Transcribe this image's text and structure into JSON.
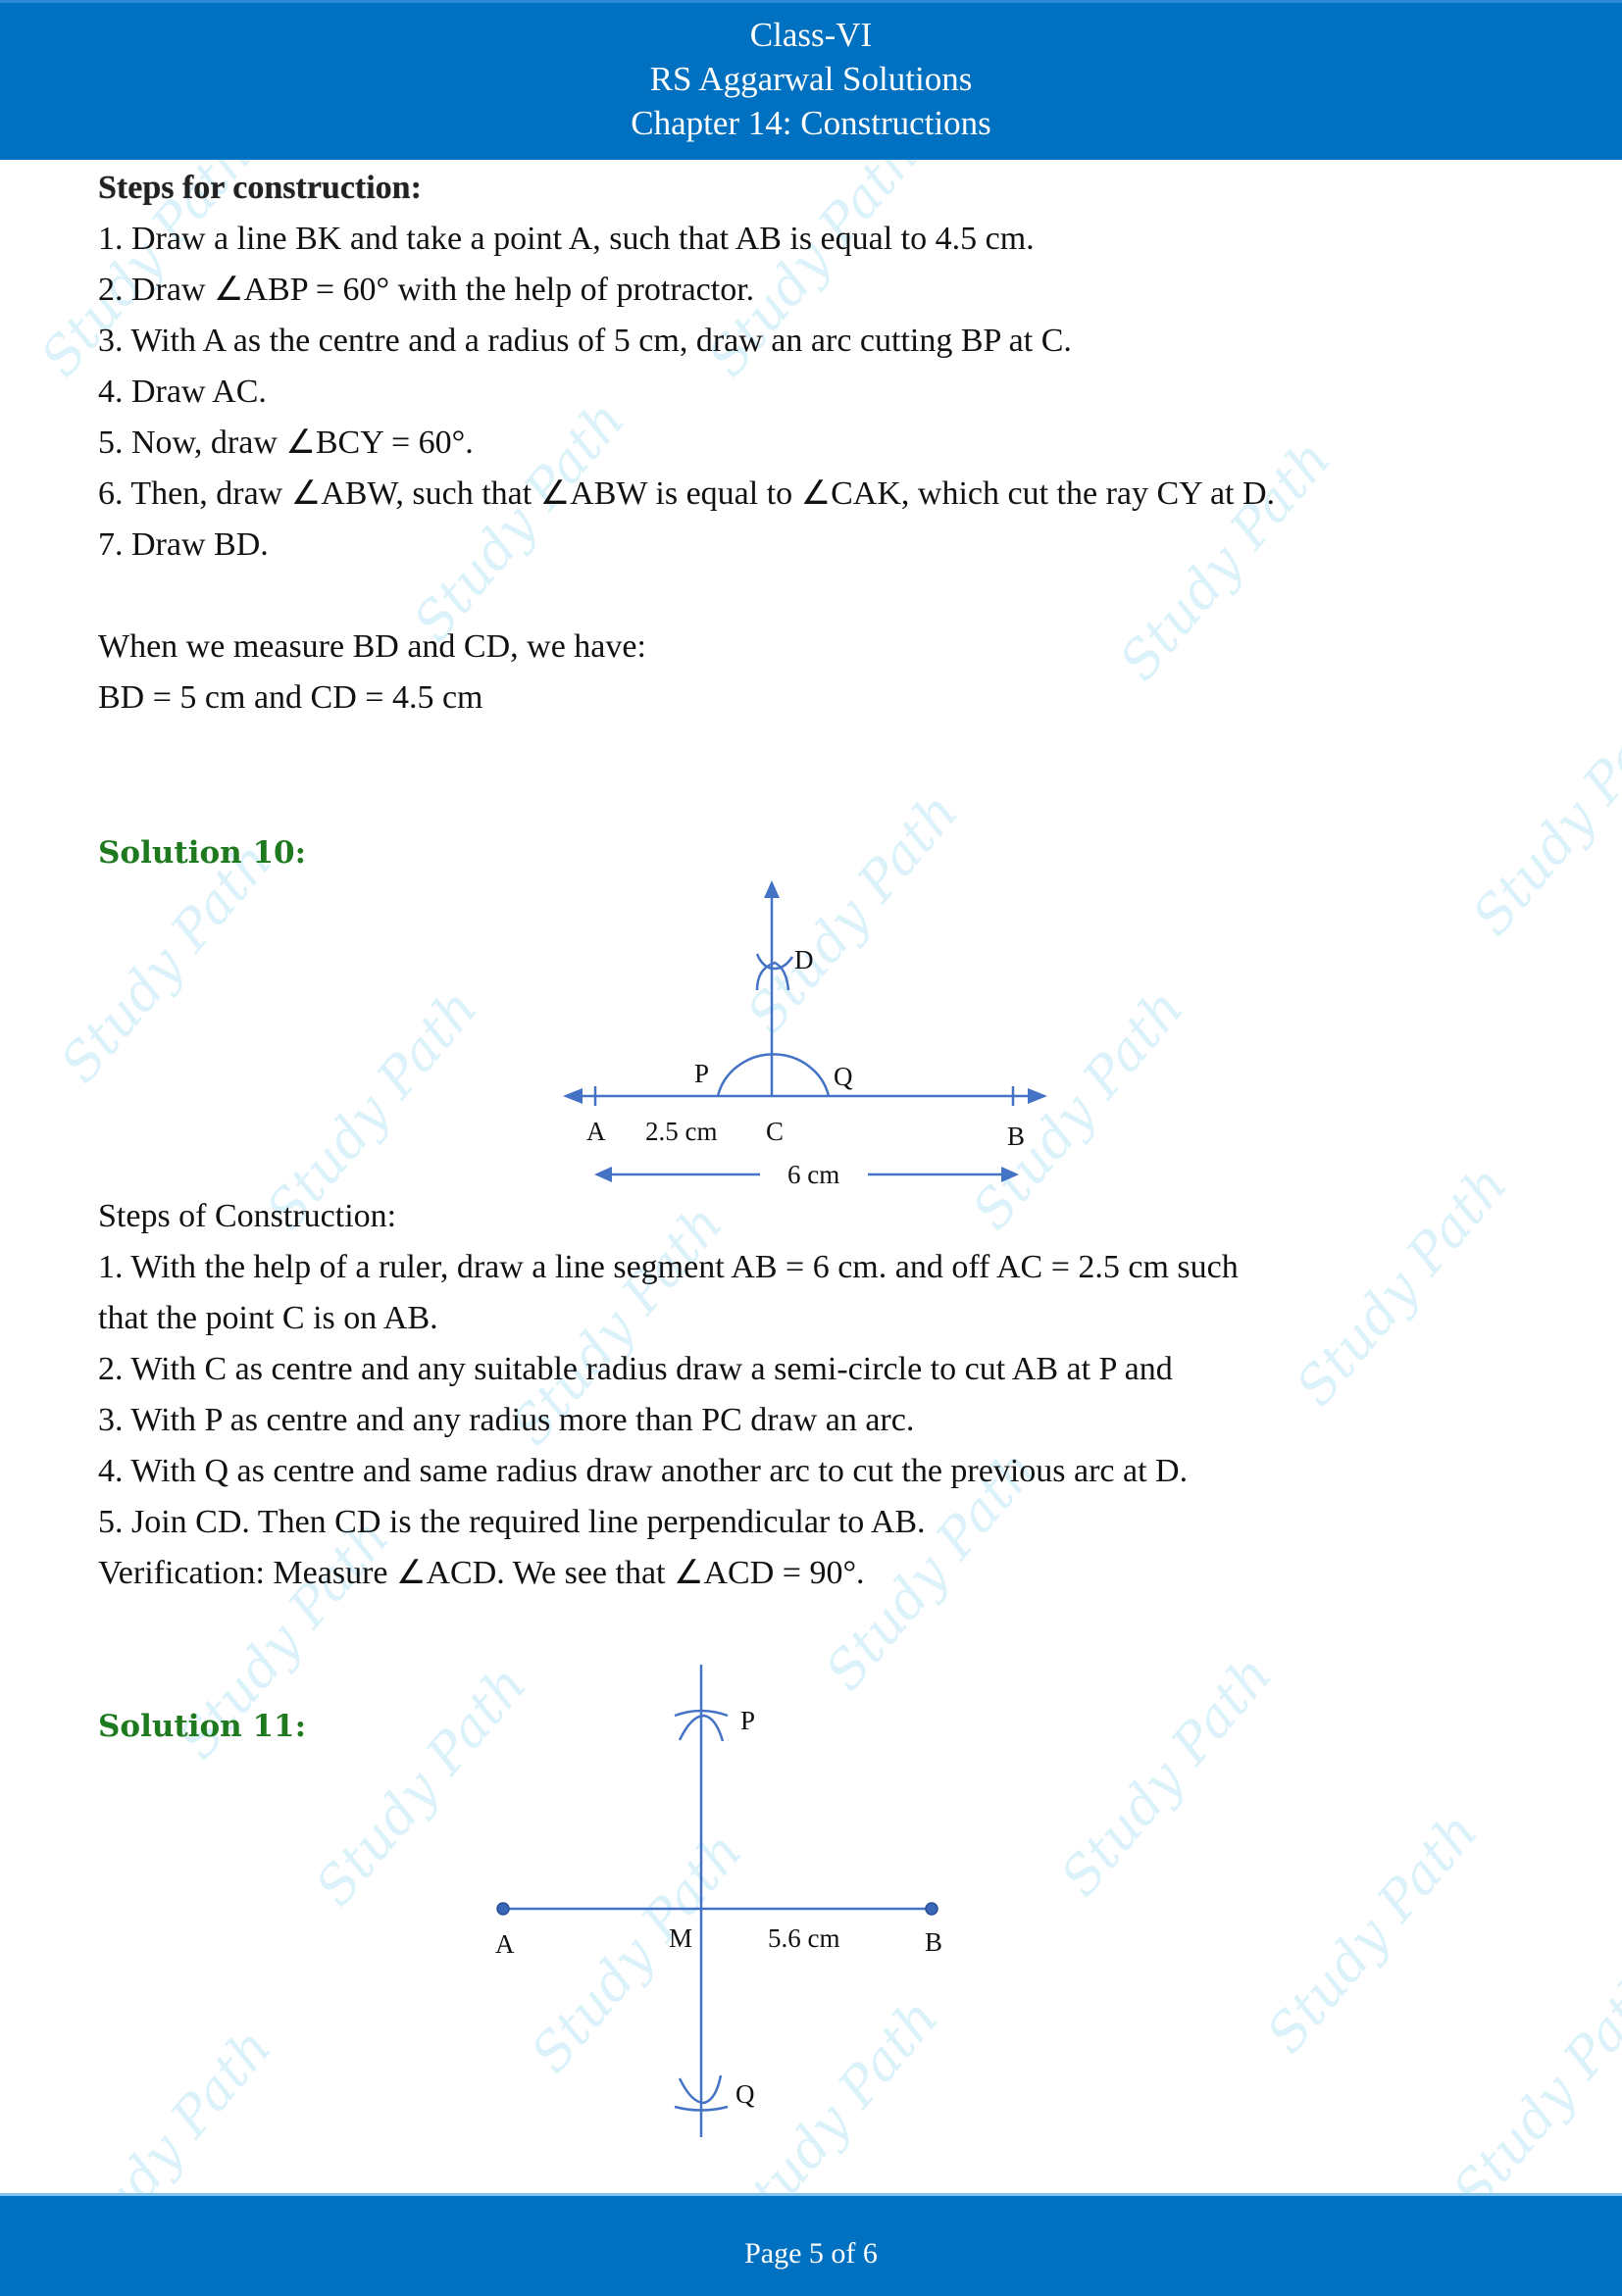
{
  "header": {
    "line1": "Class-VI",
    "line2": "RS Aggarwal Solutions",
    "line3": "Chapter 14: Constructions"
  },
  "section_prev": {
    "title": "Steps for construction:",
    "steps": [
      "1. Draw a line BK and take a point A, such that AB is equal to 4.5 cm.",
      "2. Draw ∠ABP = 60° with the help of protractor.",
      "3. With A as the centre and a radius of 5 cm, draw an arc cutting BP at C.",
      "4. Draw AC.",
      "5. Now, draw ∠BCY = 60°.",
      "6. Then, draw ∠ABW, such that ∠ABW is equal to ∠CAK, which cut the ray CY at D.",
      "7. Draw BD."
    ],
    "measure_intro": "When we measure BD and CD, we have:",
    "measure_result": "BD = 5 cm and CD = 4.5 cm"
  },
  "solution10": {
    "heading": "Solution 10:",
    "figure": {
      "labels": {
        "A": "A",
        "B": "B",
        "C": "C",
        "D": "D",
        "P": "P",
        "Q": "Q"
      },
      "ac_length": "2.5 cm",
      "ab_length": "6 cm"
    },
    "steps_title": "Steps of Construction:",
    "steps": [
      "1. With the help of a ruler, draw a line segment AB = 6 cm. and off AC = 2.5 cm such",
      "that the point C is on AB.",
      "2. With C as centre and any suitable radius draw a semi-circle to cut AB at P and",
      "3. With P as centre and any radius more than PC draw an arc.",
      "4. With Q as centre and same radius draw another arc to cut the previous arc at D.",
      "5. Join CD. Then CD is the required line perpendicular to AB."
    ],
    "verification": "Verification: Measure ∠ACD. We see that ∠ACD = 90°."
  },
  "solution11": {
    "heading": "Solution 11:",
    "figure": {
      "labels": {
        "A": "A",
        "B": "B",
        "M": "M",
        "P": "P",
        "Q": "Q"
      },
      "mb_length": "5.6 cm"
    }
  },
  "watermark": "Study Path",
  "footer": {
    "page_label": "Page 5 of 6"
  },
  "colors": {
    "brand_blue": "#0070c0",
    "solution_green": "#1f7a1f",
    "figure_line": "#4472c4"
  }
}
